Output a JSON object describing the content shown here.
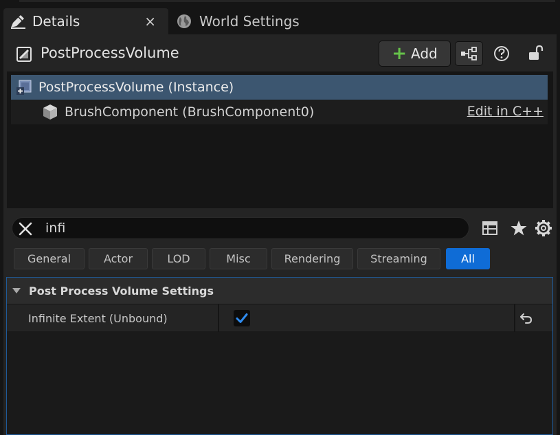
{
  "tabs": {
    "details_label": "Details",
    "close_glyph": "×",
    "world_settings_label": "World Settings"
  },
  "header": {
    "actor_name": "PostProcessVolume",
    "add_label": "Add"
  },
  "tree": {
    "root_label": "PostProcessVolume (Instance)",
    "child_label": "BrushComponent (BrushComponent0)",
    "edit_link": "Edit in C++"
  },
  "search": {
    "value": "infi"
  },
  "filters": {
    "general": "General",
    "actor": "Actor",
    "lod": "LOD",
    "misc": "Misc",
    "rendering": "Rendering",
    "streaming": "Streaming",
    "all": "All",
    "active": "All"
  },
  "section": {
    "category_label": "Post Process Volume Settings",
    "property_name": "Infinite Extent (Unbound)",
    "property_checked": true
  },
  "colors": {
    "accent": "#0f6cd6",
    "selection": "#3c5670",
    "add_plus": "#66c24a"
  },
  "icons": [
    "details-icon",
    "globe-icon",
    "actor-icon",
    "blueprint-icon",
    "help-icon",
    "lock-open-icon",
    "volume-icon",
    "cube-icon",
    "clear-icon",
    "table-icon",
    "star-icon",
    "gear-icon",
    "caret-down-icon",
    "checkmark-icon",
    "reset-arrow-icon"
  ]
}
